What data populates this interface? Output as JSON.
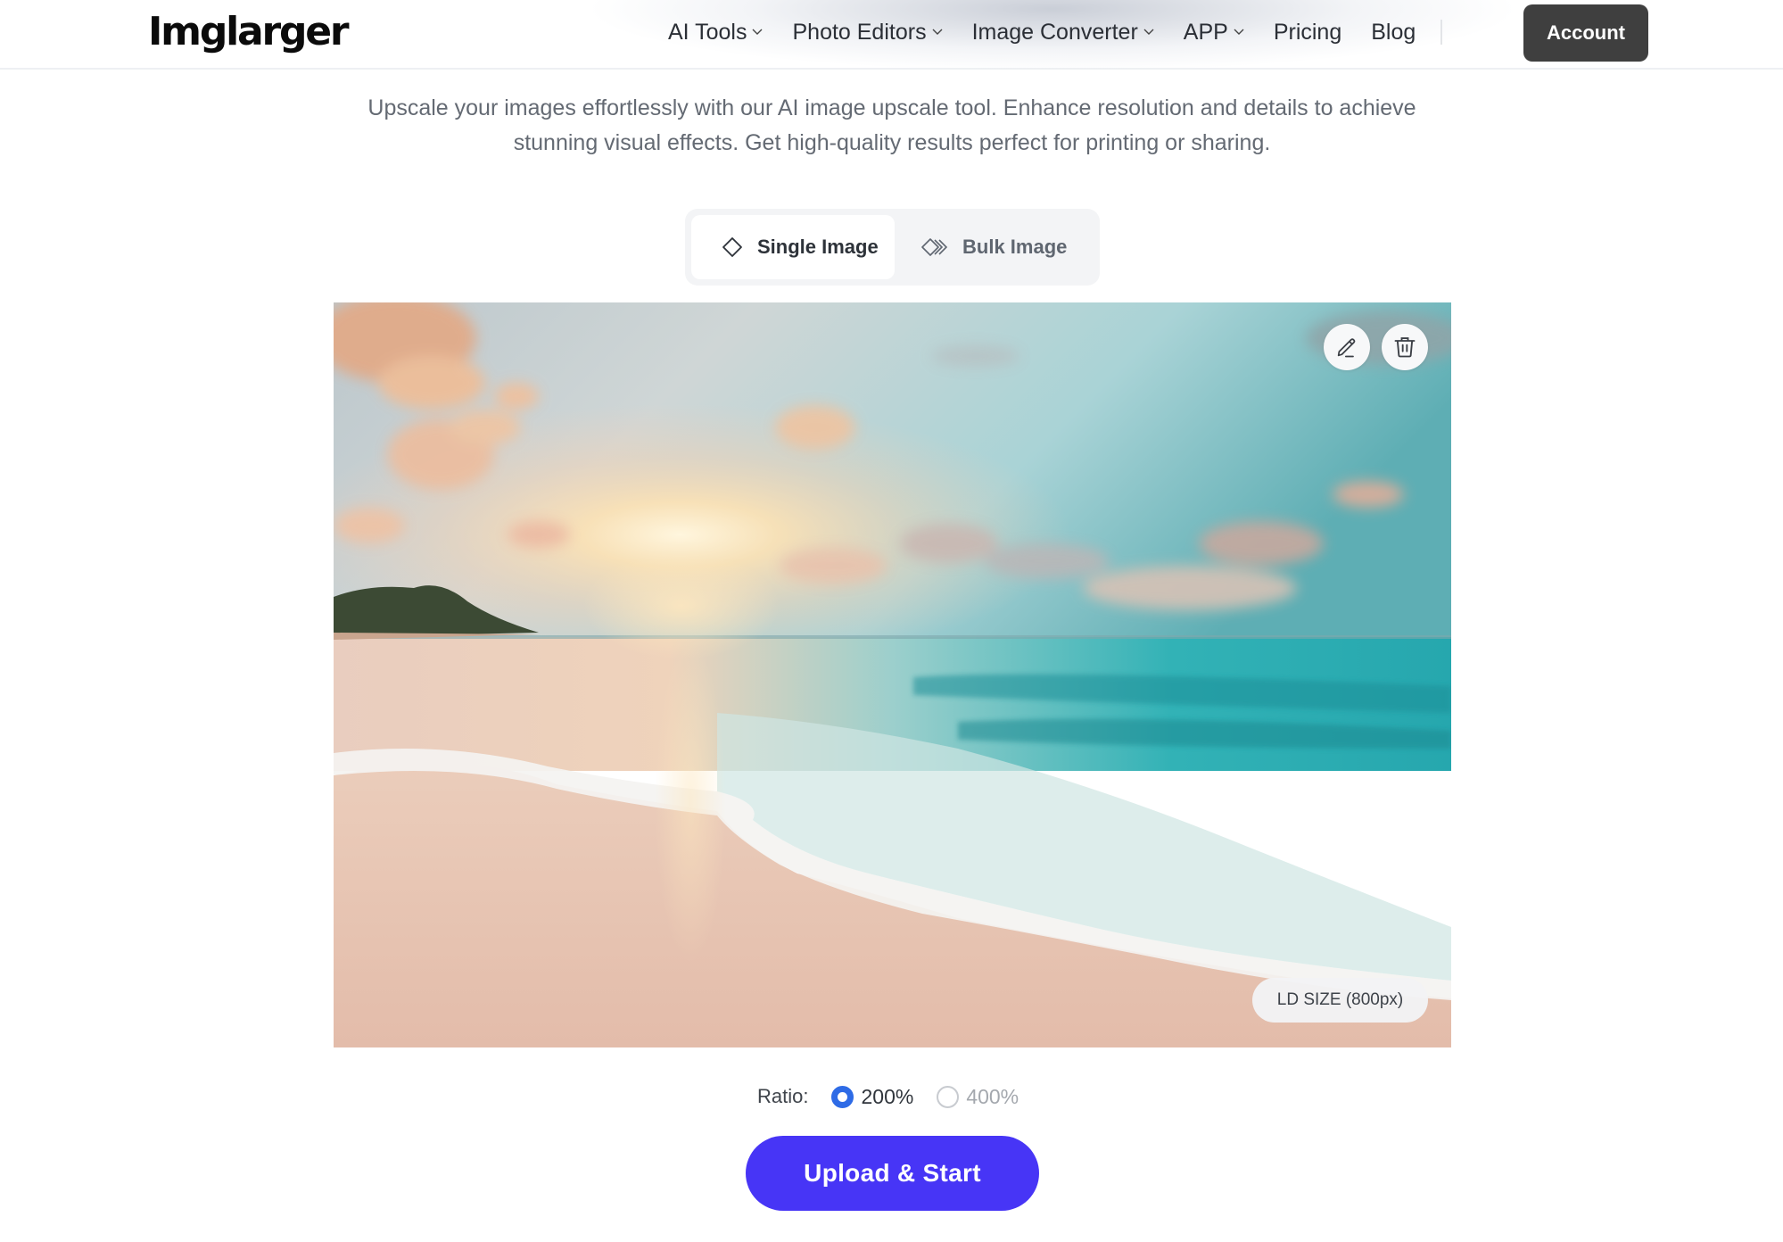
{
  "header": {
    "logo": "Imglarger",
    "nav": [
      {
        "label": "AI Tools",
        "has_dropdown": true
      },
      {
        "label": "Photo Editors",
        "has_dropdown": true
      },
      {
        "label": "Image Converter",
        "has_dropdown": true
      },
      {
        "label": "APP",
        "has_dropdown": true
      },
      {
        "label": "Pricing",
        "has_dropdown": false
      },
      {
        "label": "Blog",
        "has_dropdown": false
      }
    ],
    "account_label": "Account"
  },
  "subtitle": {
    "line1": "Upscale your images effortlessly with our AI image upscale tool. Enhance resolution and details to achieve",
    "line2": "stunning visual effects. Get high-quality results perfect for printing or sharing."
  },
  "tabs": [
    {
      "label": "Single Image",
      "icon": "diamond-icon",
      "active": true
    },
    {
      "label": "Bulk Image",
      "icon": "stacked-diamonds-icon",
      "active": false
    }
  ],
  "preview": {
    "description": "Beach at sunset with turquoise sea and waves",
    "actions": [
      {
        "name": "edit",
        "icon": "pencil-icon"
      },
      {
        "name": "delete",
        "icon": "trash-icon"
      }
    ],
    "size_badge": "LD SIZE (800px)"
  },
  "ratio": {
    "label": "Ratio:",
    "options": [
      {
        "label": "200%",
        "checked": true
      },
      {
        "label": "400%",
        "checked": false
      }
    ]
  },
  "upload_button": "Upload & Start",
  "colors": {
    "primary": "#4735f6",
    "account_bg": "#3f3f3f",
    "radio_checked": "#2e6be6"
  }
}
